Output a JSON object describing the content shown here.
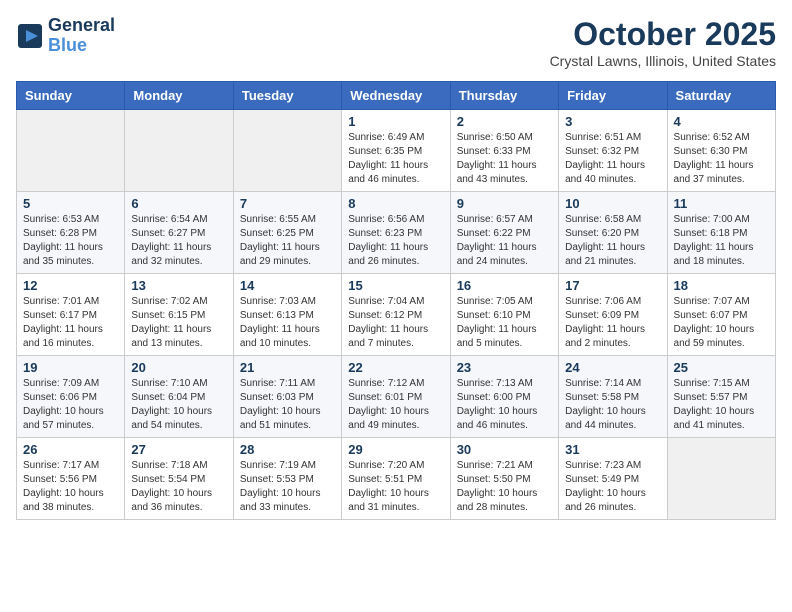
{
  "header": {
    "logo_line1": "General",
    "logo_line2": "Blue",
    "month_title": "October 2025",
    "location": "Crystal Lawns, Illinois, United States"
  },
  "days_of_week": [
    "Sunday",
    "Monday",
    "Tuesday",
    "Wednesday",
    "Thursday",
    "Friday",
    "Saturday"
  ],
  "weeks": [
    [
      {
        "day": "",
        "info": ""
      },
      {
        "day": "",
        "info": ""
      },
      {
        "day": "",
        "info": ""
      },
      {
        "day": "1",
        "info": "Sunrise: 6:49 AM\nSunset: 6:35 PM\nDaylight: 11 hours\nand 46 minutes."
      },
      {
        "day": "2",
        "info": "Sunrise: 6:50 AM\nSunset: 6:33 PM\nDaylight: 11 hours\nand 43 minutes."
      },
      {
        "day": "3",
        "info": "Sunrise: 6:51 AM\nSunset: 6:32 PM\nDaylight: 11 hours\nand 40 minutes."
      },
      {
        "day": "4",
        "info": "Sunrise: 6:52 AM\nSunset: 6:30 PM\nDaylight: 11 hours\nand 37 minutes."
      }
    ],
    [
      {
        "day": "5",
        "info": "Sunrise: 6:53 AM\nSunset: 6:28 PM\nDaylight: 11 hours\nand 35 minutes."
      },
      {
        "day": "6",
        "info": "Sunrise: 6:54 AM\nSunset: 6:27 PM\nDaylight: 11 hours\nand 32 minutes."
      },
      {
        "day": "7",
        "info": "Sunrise: 6:55 AM\nSunset: 6:25 PM\nDaylight: 11 hours\nand 29 minutes."
      },
      {
        "day": "8",
        "info": "Sunrise: 6:56 AM\nSunset: 6:23 PM\nDaylight: 11 hours\nand 26 minutes."
      },
      {
        "day": "9",
        "info": "Sunrise: 6:57 AM\nSunset: 6:22 PM\nDaylight: 11 hours\nand 24 minutes."
      },
      {
        "day": "10",
        "info": "Sunrise: 6:58 AM\nSunset: 6:20 PM\nDaylight: 11 hours\nand 21 minutes."
      },
      {
        "day": "11",
        "info": "Sunrise: 7:00 AM\nSunset: 6:18 PM\nDaylight: 11 hours\nand 18 minutes."
      }
    ],
    [
      {
        "day": "12",
        "info": "Sunrise: 7:01 AM\nSunset: 6:17 PM\nDaylight: 11 hours\nand 16 minutes."
      },
      {
        "day": "13",
        "info": "Sunrise: 7:02 AM\nSunset: 6:15 PM\nDaylight: 11 hours\nand 13 minutes."
      },
      {
        "day": "14",
        "info": "Sunrise: 7:03 AM\nSunset: 6:13 PM\nDaylight: 11 hours\nand 10 minutes."
      },
      {
        "day": "15",
        "info": "Sunrise: 7:04 AM\nSunset: 6:12 PM\nDaylight: 11 hours\nand 7 minutes."
      },
      {
        "day": "16",
        "info": "Sunrise: 7:05 AM\nSunset: 6:10 PM\nDaylight: 11 hours\nand 5 minutes."
      },
      {
        "day": "17",
        "info": "Sunrise: 7:06 AM\nSunset: 6:09 PM\nDaylight: 11 hours\nand 2 minutes."
      },
      {
        "day": "18",
        "info": "Sunrise: 7:07 AM\nSunset: 6:07 PM\nDaylight: 10 hours\nand 59 minutes."
      }
    ],
    [
      {
        "day": "19",
        "info": "Sunrise: 7:09 AM\nSunset: 6:06 PM\nDaylight: 10 hours\nand 57 minutes."
      },
      {
        "day": "20",
        "info": "Sunrise: 7:10 AM\nSunset: 6:04 PM\nDaylight: 10 hours\nand 54 minutes."
      },
      {
        "day": "21",
        "info": "Sunrise: 7:11 AM\nSunset: 6:03 PM\nDaylight: 10 hours\nand 51 minutes."
      },
      {
        "day": "22",
        "info": "Sunrise: 7:12 AM\nSunset: 6:01 PM\nDaylight: 10 hours\nand 49 minutes."
      },
      {
        "day": "23",
        "info": "Sunrise: 7:13 AM\nSunset: 6:00 PM\nDaylight: 10 hours\nand 46 minutes."
      },
      {
        "day": "24",
        "info": "Sunrise: 7:14 AM\nSunset: 5:58 PM\nDaylight: 10 hours\nand 44 minutes."
      },
      {
        "day": "25",
        "info": "Sunrise: 7:15 AM\nSunset: 5:57 PM\nDaylight: 10 hours\nand 41 minutes."
      }
    ],
    [
      {
        "day": "26",
        "info": "Sunrise: 7:17 AM\nSunset: 5:56 PM\nDaylight: 10 hours\nand 38 minutes."
      },
      {
        "day": "27",
        "info": "Sunrise: 7:18 AM\nSunset: 5:54 PM\nDaylight: 10 hours\nand 36 minutes."
      },
      {
        "day": "28",
        "info": "Sunrise: 7:19 AM\nSunset: 5:53 PM\nDaylight: 10 hours\nand 33 minutes."
      },
      {
        "day": "29",
        "info": "Sunrise: 7:20 AM\nSunset: 5:51 PM\nDaylight: 10 hours\nand 31 minutes."
      },
      {
        "day": "30",
        "info": "Sunrise: 7:21 AM\nSunset: 5:50 PM\nDaylight: 10 hours\nand 28 minutes."
      },
      {
        "day": "31",
        "info": "Sunrise: 7:23 AM\nSunset: 5:49 PM\nDaylight: 10 hours\nand 26 minutes."
      },
      {
        "day": "",
        "info": ""
      }
    ]
  ]
}
